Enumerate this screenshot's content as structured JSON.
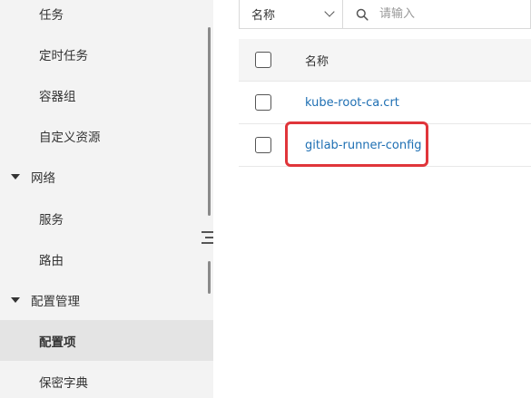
{
  "sidebar": {
    "items": [
      {
        "label": "任务"
      },
      {
        "label": "定时任务"
      },
      {
        "label": "容器组"
      },
      {
        "label": "自定义资源"
      },
      {
        "label": "网络"
      },
      {
        "label": "服务"
      },
      {
        "label": "路由"
      },
      {
        "label": "配置管理"
      },
      {
        "label": "配置项"
      },
      {
        "label": "保密字典"
      }
    ],
    "active": "配置项"
  },
  "filter": {
    "field_label": "名称",
    "search_placeholder": "请输入",
    "search_value": ""
  },
  "table": {
    "header": {
      "name": "名称"
    },
    "rows": [
      {
        "name": "kube-root-ca.crt"
      },
      {
        "name": "gitlab-runner-config",
        "highlighted": true
      }
    ]
  },
  "colors": {
    "link": "#1e6fb3",
    "highlight": "#e0353a",
    "sidebar_bg": "#f3f3f3",
    "sidebar_active_bg": "#e4e4e4"
  }
}
